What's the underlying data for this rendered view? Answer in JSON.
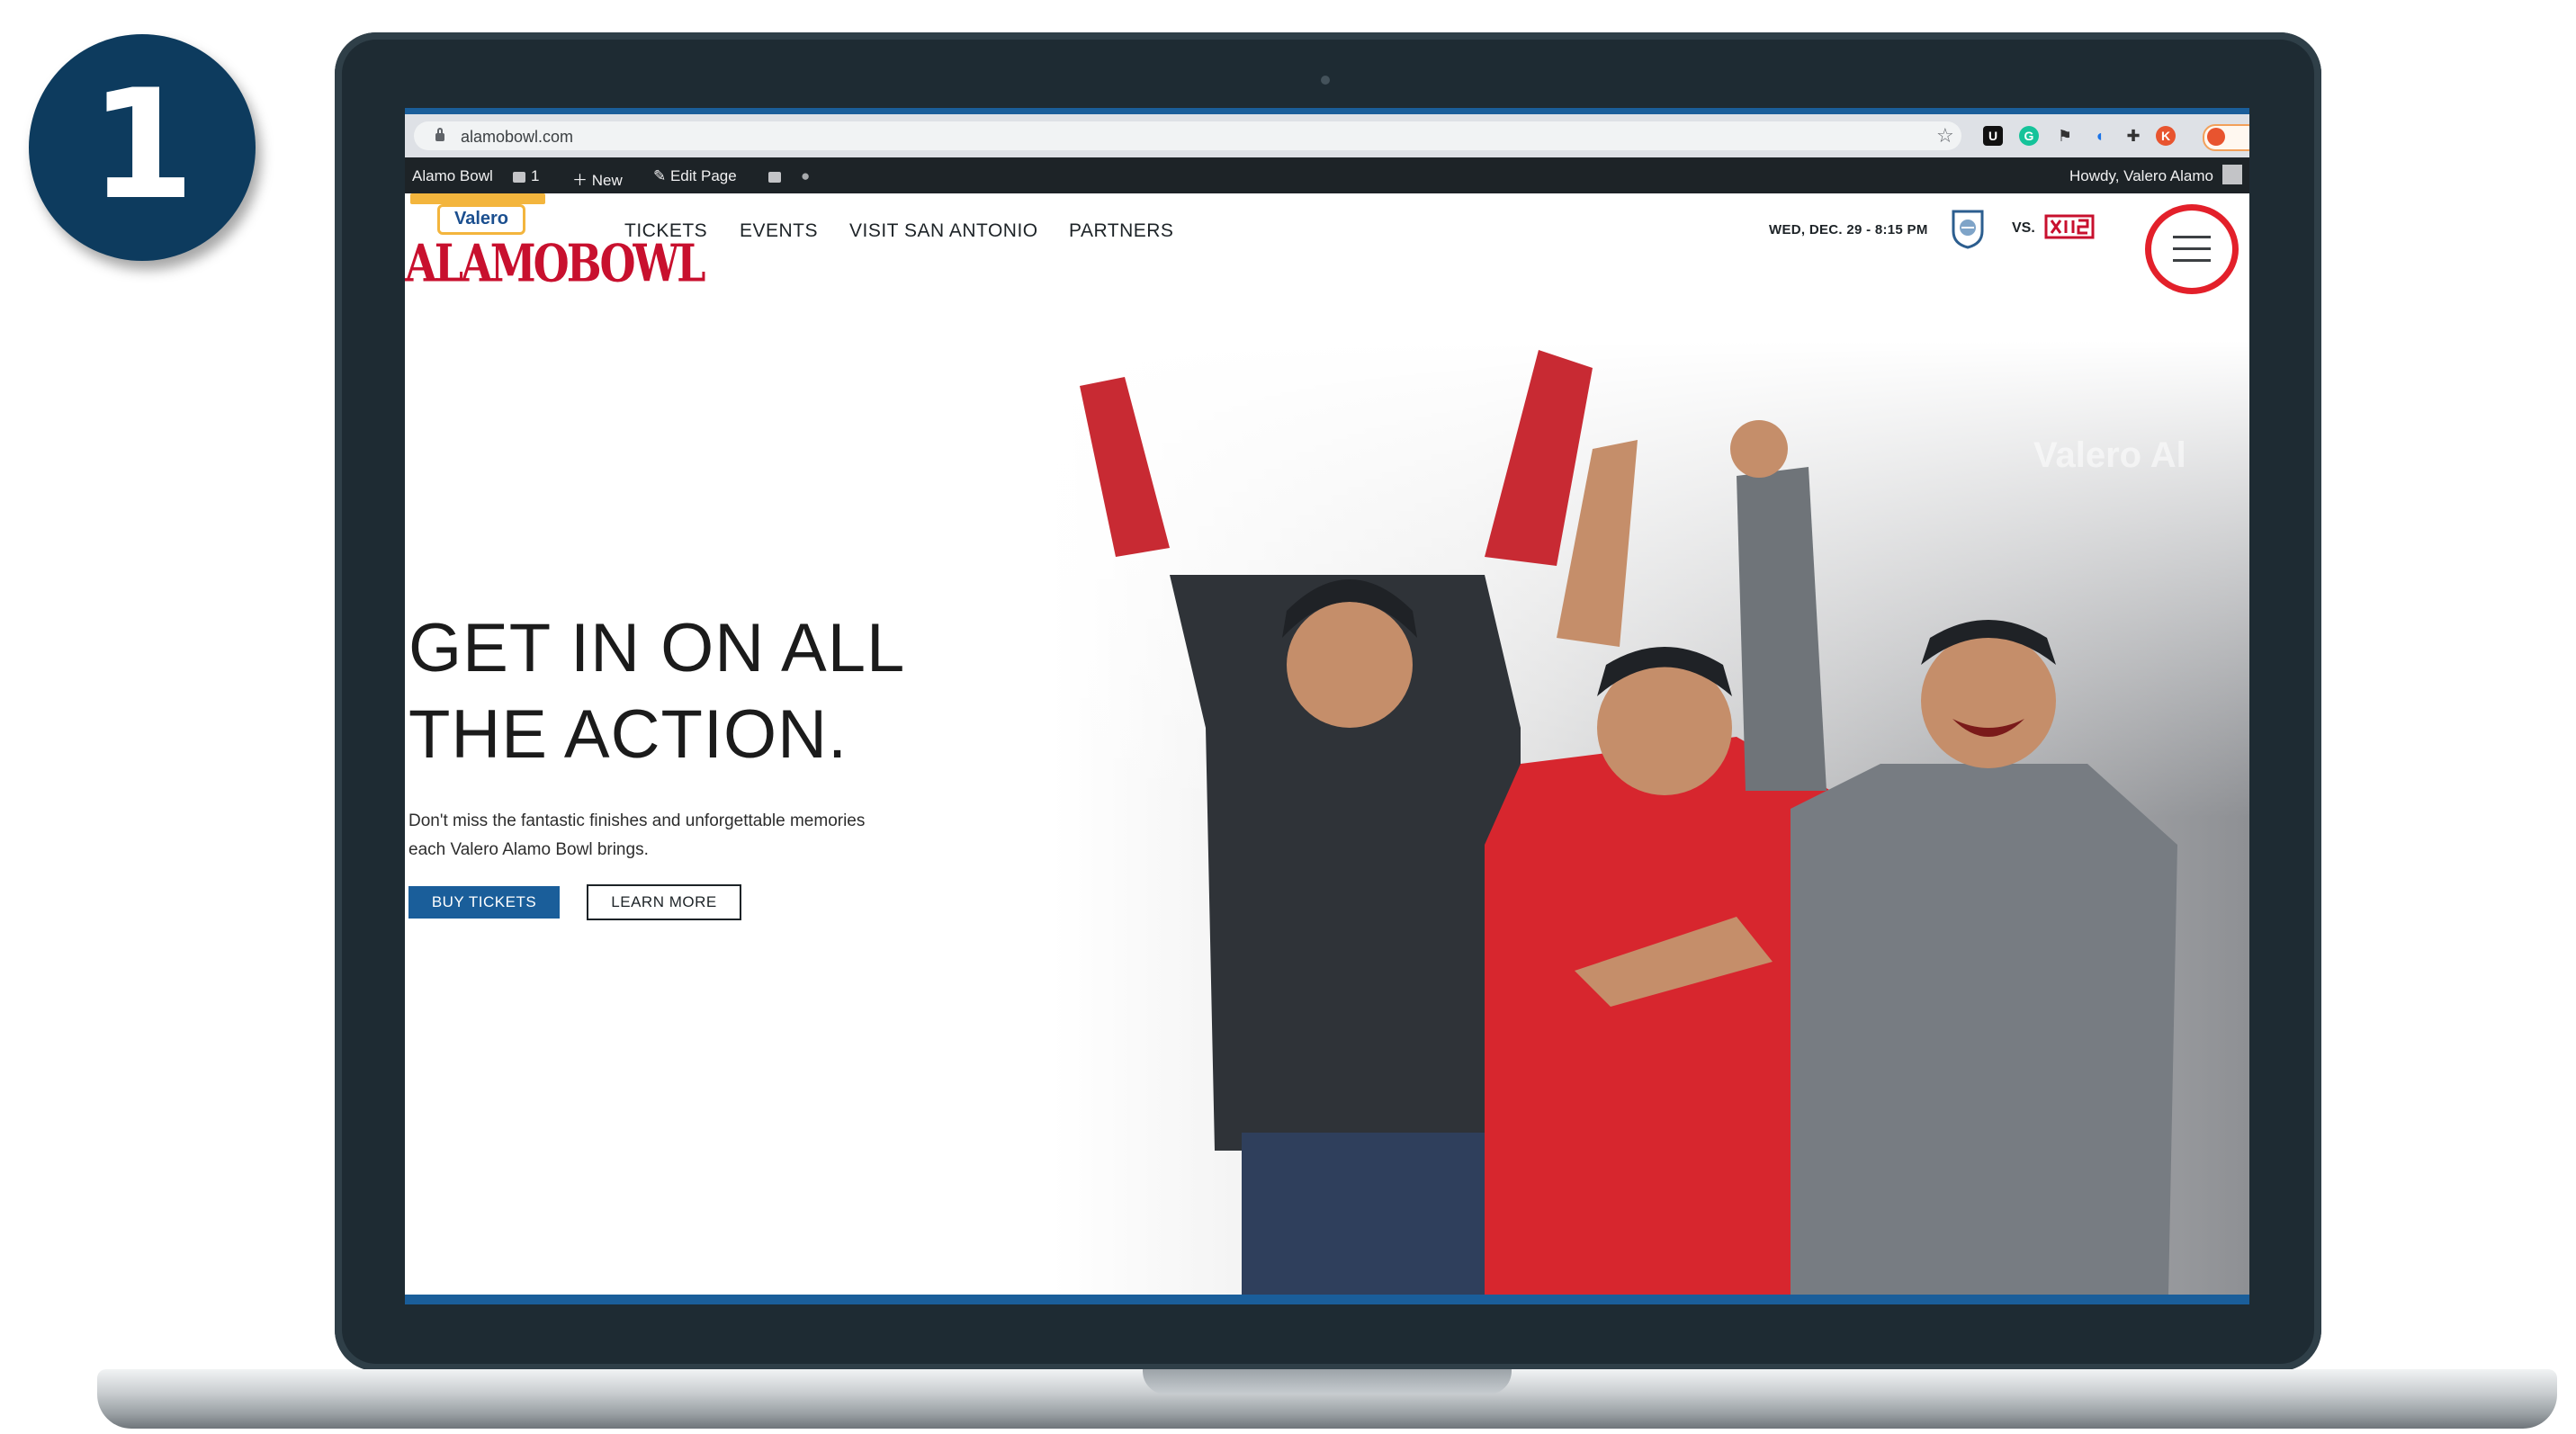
{
  "step": {
    "number": "1"
  },
  "browser": {
    "url": "alamobowl.com",
    "extensions": [
      "u-icon",
      "grammarly-icon",
      "flag-icon",
      "audio-icon",
      "puzzle-icon",
      "profile-avatar"
    ]
  },
  "admin_bar": {
    "site_name": "Alamo Bowl",
    "comments_count": "1",
    "new_label": "New",
    "edit_label": "Edit Page",
    "howdy": "Howdy, Valero Alamo"
  },
  "header": {
    "logo_top": "Valero",
    "logo_main": "ALAMOBOWL",
    "nav": [
      {
        "label": "TICKETS"
      },
      {
        "label": "EVENTS"
      },
      {
        "label": "VISIT SAN ANTONIO"
      },
      {
        "label": "PARTNERS"
      }
    ],
    "game_date": "WED, DEC. 29 - 8:15 PM",
    "vs_label": "VS."
  },
  "hero": {
    "title_line1": "GET IN ON ALL",
    "title_line2": "THE ACTION.",
    "copy_line1": "Don't miss the fantastic finishes and unforgettable memories",
    "copy_line2": "each Valero Alamo Bowl brings.",
    "buy_label": "BUY TICKETS",
    "learn_label": "LEARN MORE"
  },
  "colors": {
    "brand_blue": "#1a5e9a",
    "brand_red": "#c8102e",
    "highlight_ring": "#e3202a",
    "badge_navy": "#0d3b5e"
  }
}
